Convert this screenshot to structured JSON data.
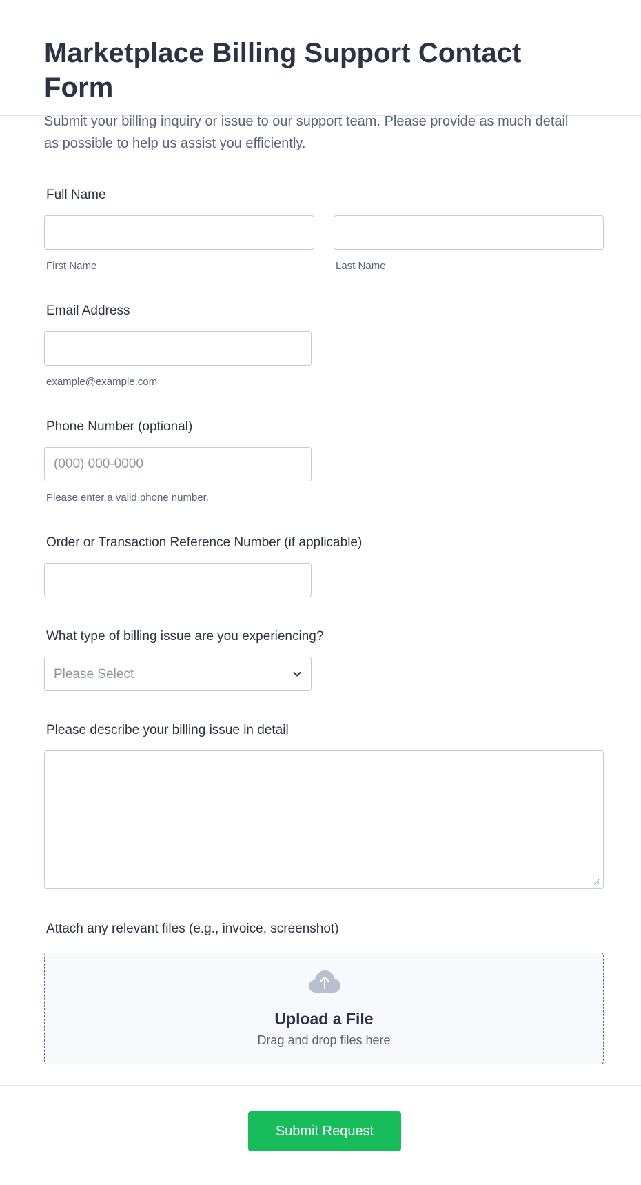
{
  "form": {
    "title": "Marketplace Billing Support Contact Form",
    "subtitle": "Submit your billing inquiry or issue to our support team. Please provide as much detail as possible to help us assist you efficiently."
  },
  "fields": {
    "full_name": {
      "label": "Full Name",
      "first_sublabel": "First Name",
      "last_sublabel": "Last Name",
      "first_value": "",
      "last_value": ""
    },
    "email": {
      "label": "Email Address",
      "sublabel": "example@example.com",
      "value": ""
    },
    "phone": {
      "label": "Phone Number (optional)",
      "placeholder": "(000) 000-0000",
      "sublabel": "Please enter a valid phone number.",
      "value": ""
    },
    "reference": {
      "label": "Order or Transaction Reference Number (if applicable)",
      "value": ""
    },
    "issue_type": {
      "label": "What type of billing issue are you experiencing?",
      "selected": "Please Select"
    },
    "description": {
      "label": "Please describe your billing issue in detail",
      "value": ""
    },
    "attachments": {
      "label": "Attach any relevant files (e.g., invoice, screenshot)",
      "upload_title": "Upload a File",
      "upload_hint": "Drag and drop files here",
      "icon": "cloud-upload-icon"
    }
  },
  "submit": {
    "label": "Submit Request"
  },
  "colors": {
    "text": "#2c3345",
    "muted": "#57647e",
    "border": "#c3cad8",
    "submit": "#18bd5b",
    "upload_bg": "#f8f9fc"
  }
}
